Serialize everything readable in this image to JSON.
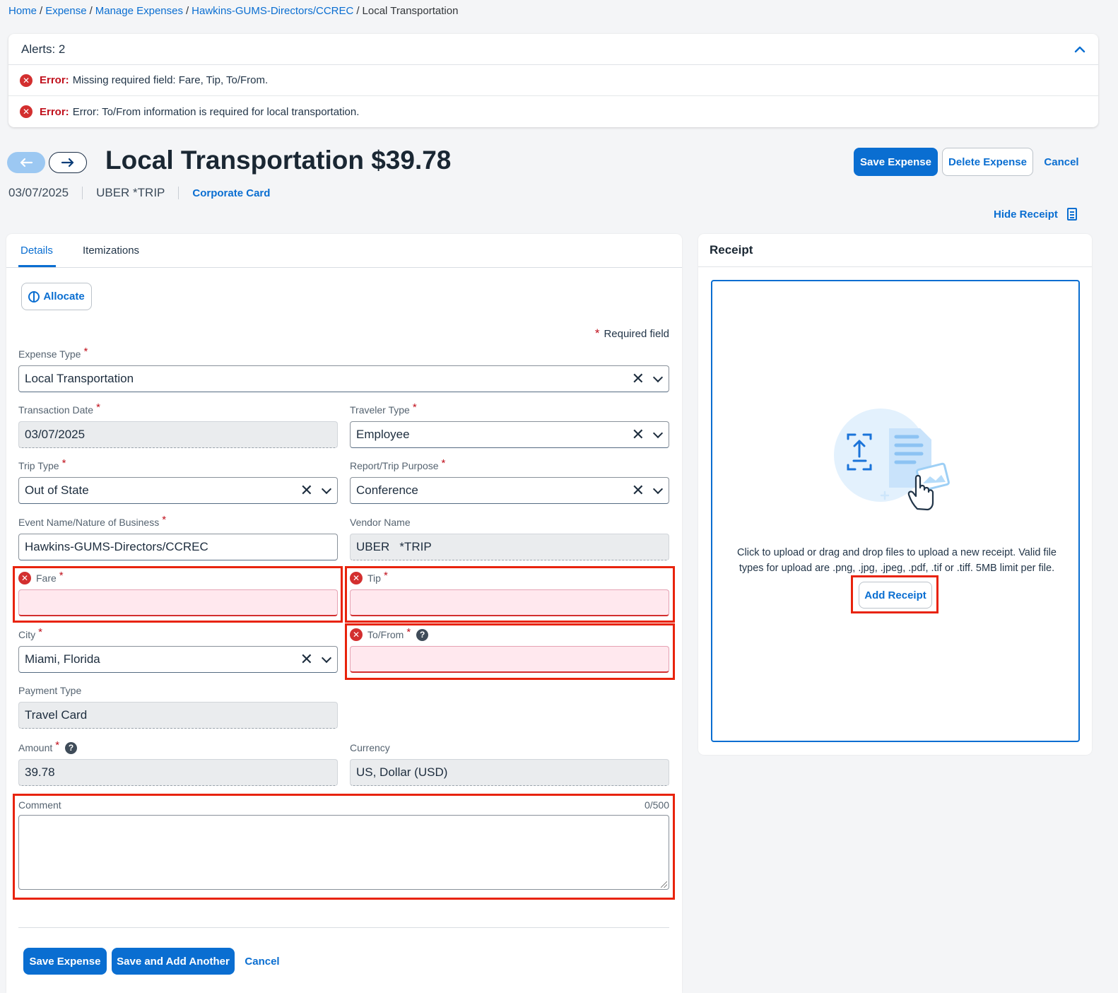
{
  "breadcrumb": {
    "items": [
      "Home",
      "Expense",
      "Manage Expenses",
      "Hawkins-GUMS-Directors/CCREC"
    ],
    "current": "Local Transportation",
    "separator": "/"
  },
  "alerts": {
    "title": "Alerts: 2",
    "items": [
      {
        "label": "Error:",
        "message": "Missing required field: Fare, Tip, To/From."
      },
      {
        "label": "Error:",
        "message": "Error: To/From information is required for local transportation."
      }
    ]
  },
  "header": {
    "title": "Local Transportation $39.78",
    "date": "03/07/2025",
    "vendor": "UBER *TRIP",
    "payment": "Corporate Card",
    "save_label": "Save Expense",
    "delete_label": "Delete Expense",
    "cancel_label": "Cancel",
    "hide_receipt_label": "Hide Receipt"
  },
  "tabs": [
    {
      "label": "Details",
      "active": true
    },
    {
      "label": "Itemizations",
      "active": false
    }
  ],
  "form": {
    "allocate_label": "Allocate",
    "required_note": "Required field",
    "required_star": "*",
    "fields": {
      "expense_type": {
        "label": "Expense Type",
        "value": "Local Transportation"
      },
      "transaction_date": {
        "label": "Transaction Date",
        "value": "03/07/2025"
      },
      "traveler_type": {
        "label": "Traveler Type",
        "value": "Employee"
      },
      "trip_type": {
        "label": "Trip Type",
        "value": "Out of State"
      },
      "report_purpose": {
        "label": "Report/Trip Purpose",
        "value": "Conference"
      },
      "event_name": {
        "label": "Event Name/Nature of Business",
        "value": "Hawkins-GUMS-Directors/CCREC"
      },
      "vendor_name": {
        "label": "Vendor Name",
        "value": "UBER   *TRIP"
      },
      "fare": {
        "label": "Fare",
        "value": ""
      },
      "tip": {
        "label": "Tip",
        "value": ""
      },
      "city": {
        "label": "City",
        "value": "Miami, Florida"
      },
      "to_from": {
        "label": "To/From",
        "value": ""
      },
      "payment_type": {
        "label": "Payment Type",
        "value": "Travel Card"
      },
      "amount": {
        "label": "Amount",
        "value": "39.78"
      },
      "currency": {
        "label": "Currency",
        "value": "US, Dollar (USD)"
      },
      "comment": {
        "label": "Comment",
        "value": "",
        "counter": "0/500"
      }
    },
    "save_label": "Save Expense",
    "save_add_label": "Save and Add Another",
    "cancel_label": "Cancel"
  },
  "receipt": {
    "title": "Receipt",
    "instructions": "Click to upload or drag and drop files to upload a new receipt. Valid file types for upload are .png, .jpg, .jpeg, .pdf, .tif or .tiff. 5MB limit per file.",
    "add_label": "Add Receipt"
  },
  "colors": {
    "accent": "#0a6ed1",
    "error": "#d32f2f",
    "highlight_box": "#e8230c"
  },
  "icons": [
    "arrow-left-icon",
    "arrow-right-icon",
    "chevron-up-icon",
    "error-icon",
    "clear-icon",
    "chevron-down-icon",
    "help-icon",
    "allocate-pie-icon",
    "receipt-icon",
    "upload-illustration"
  ]
}
